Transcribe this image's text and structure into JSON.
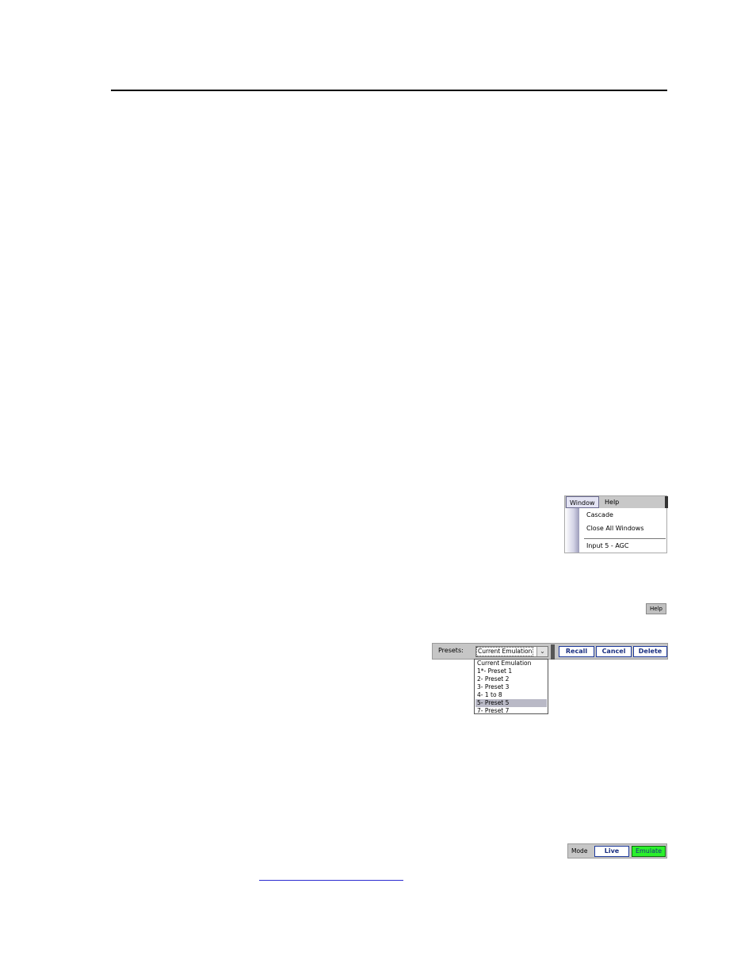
{
  "window_menu": {
    "menus": [
      "Window",
      "Help"
    ],
    "items": [
      "Cascade",
      "Close All Windows",
      "Input 5 - AGC"
    ]
  },
  "help_button": {
    "label": "Help"
  },
  "presets": {
    "label": "Presets:",
    "selected_value": "Current Emulation",
    "buttons": {
      "recall": "Recall",
      "cancel": "Cancel",
      "delete": "Delete"
    },
    "options": [
      "Current Emulation",
      "1*- Preset 1",
      "2- Preset 2",
      "3- Preset 3",
      "4- 1 to 8",
      "5- Preset 5",
      "7- Preset 7"
    ],
    "highlighted_option": "5- Preset 5"
  },
  "mode": {
    "label": "Mode",
    "live_label": "Live",
    "emulate_label": "Emulate",
    "active_color": "#2bf02b"
  }
}
